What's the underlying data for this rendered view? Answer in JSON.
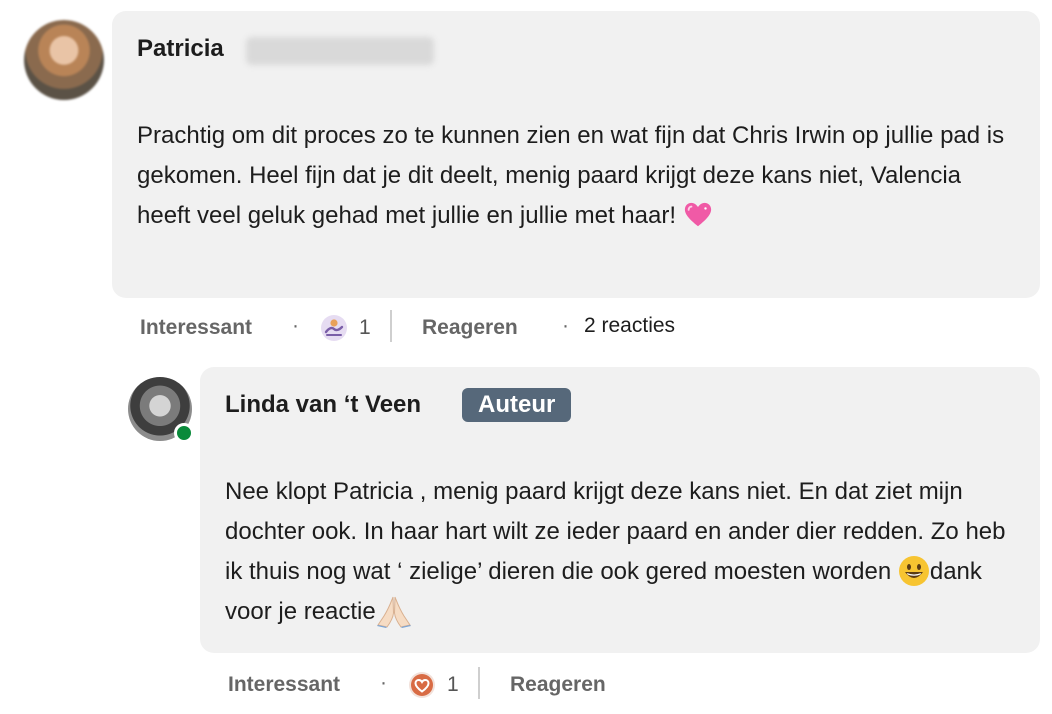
{
  "comments": [
    {
      "author": "Patricia",
      "text": "Prachtig om dit proces zo te kunnen zien en wat fijn dat Chris Irwin op jullie pad is gekomen. Heel fijn dat je dit deelt, menig paard krijgt deze kans niet, Valencia heeft veel geluk gehad met jullie en jullie met haar!",
      "emoji": "heart-emoji",
      "actions": {
        "like_label": "Interessant",
        "reaction_icon": "insightful-reaction-icon",
        "reaction_count": "1",
        "reply_label": "Reageren",
        "replies_count": "2 reacties"
      }
    },
    {
      "author": "Linda van ‘t Veen",
      "badge": "Auteur",
      "text_part1": "Nee klopt Patricia , menig paard krijgt deze kans niet. En dat ziet mijn dochter ook. In haar hart wilt ze ieder paard en ander dier redden. Zo heb ik thuis nog wat ‘ zielige’ dieren die ook gered moesten worden",
      "text_part2": "dank voor je reactie",
      "actions": {
        "like_label": "Interessant",
        "reaction_icon": "love-reaction-icon",
        "reaction_count": "1",
        "reply_label": "Reageren"
      }
    }
  ],
  "colors": {
    "bubble": "#f1f1f1",
    "badge": "#56687a",
    "online": "#0a8a3a"
  },
  "separator": "·"
}
